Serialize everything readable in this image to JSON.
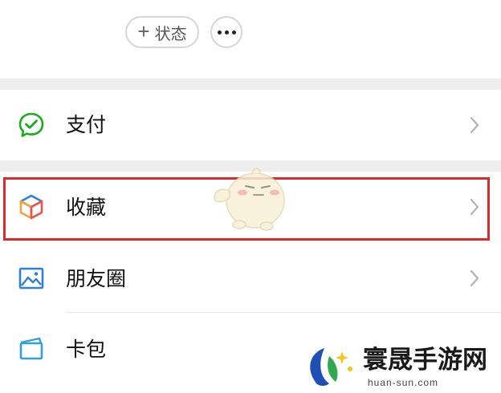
{
  "profile": {
    "status_button_label": "状态",
    "more_button_icon": "more-dots-icon"
  },
  "menu": {
    "pay": {
      "label": "支付",
      "icon": "wechat-pay-icon"
    },
    "favorites": {
      "label": "收藏",
      "icon": "favorites-cube-icon"
    },
    "moments": {
      "label": "朋友圈",
      "icon": "picture-icon"
    },
    "cards": {
      "label": "卡包",
      "icon": "card-wallet-icon"
    }
  },
  "watermark": {
    "title": "寰晟手游网",
    "url": "huan-sun.com"
  },
  "colors": {
    "highlight": "#d92b2b",
    "pay_green": "#1aad19",
    "icon_blue": "#2f7fd6",
    "separator": "#ededed"
  }
}
